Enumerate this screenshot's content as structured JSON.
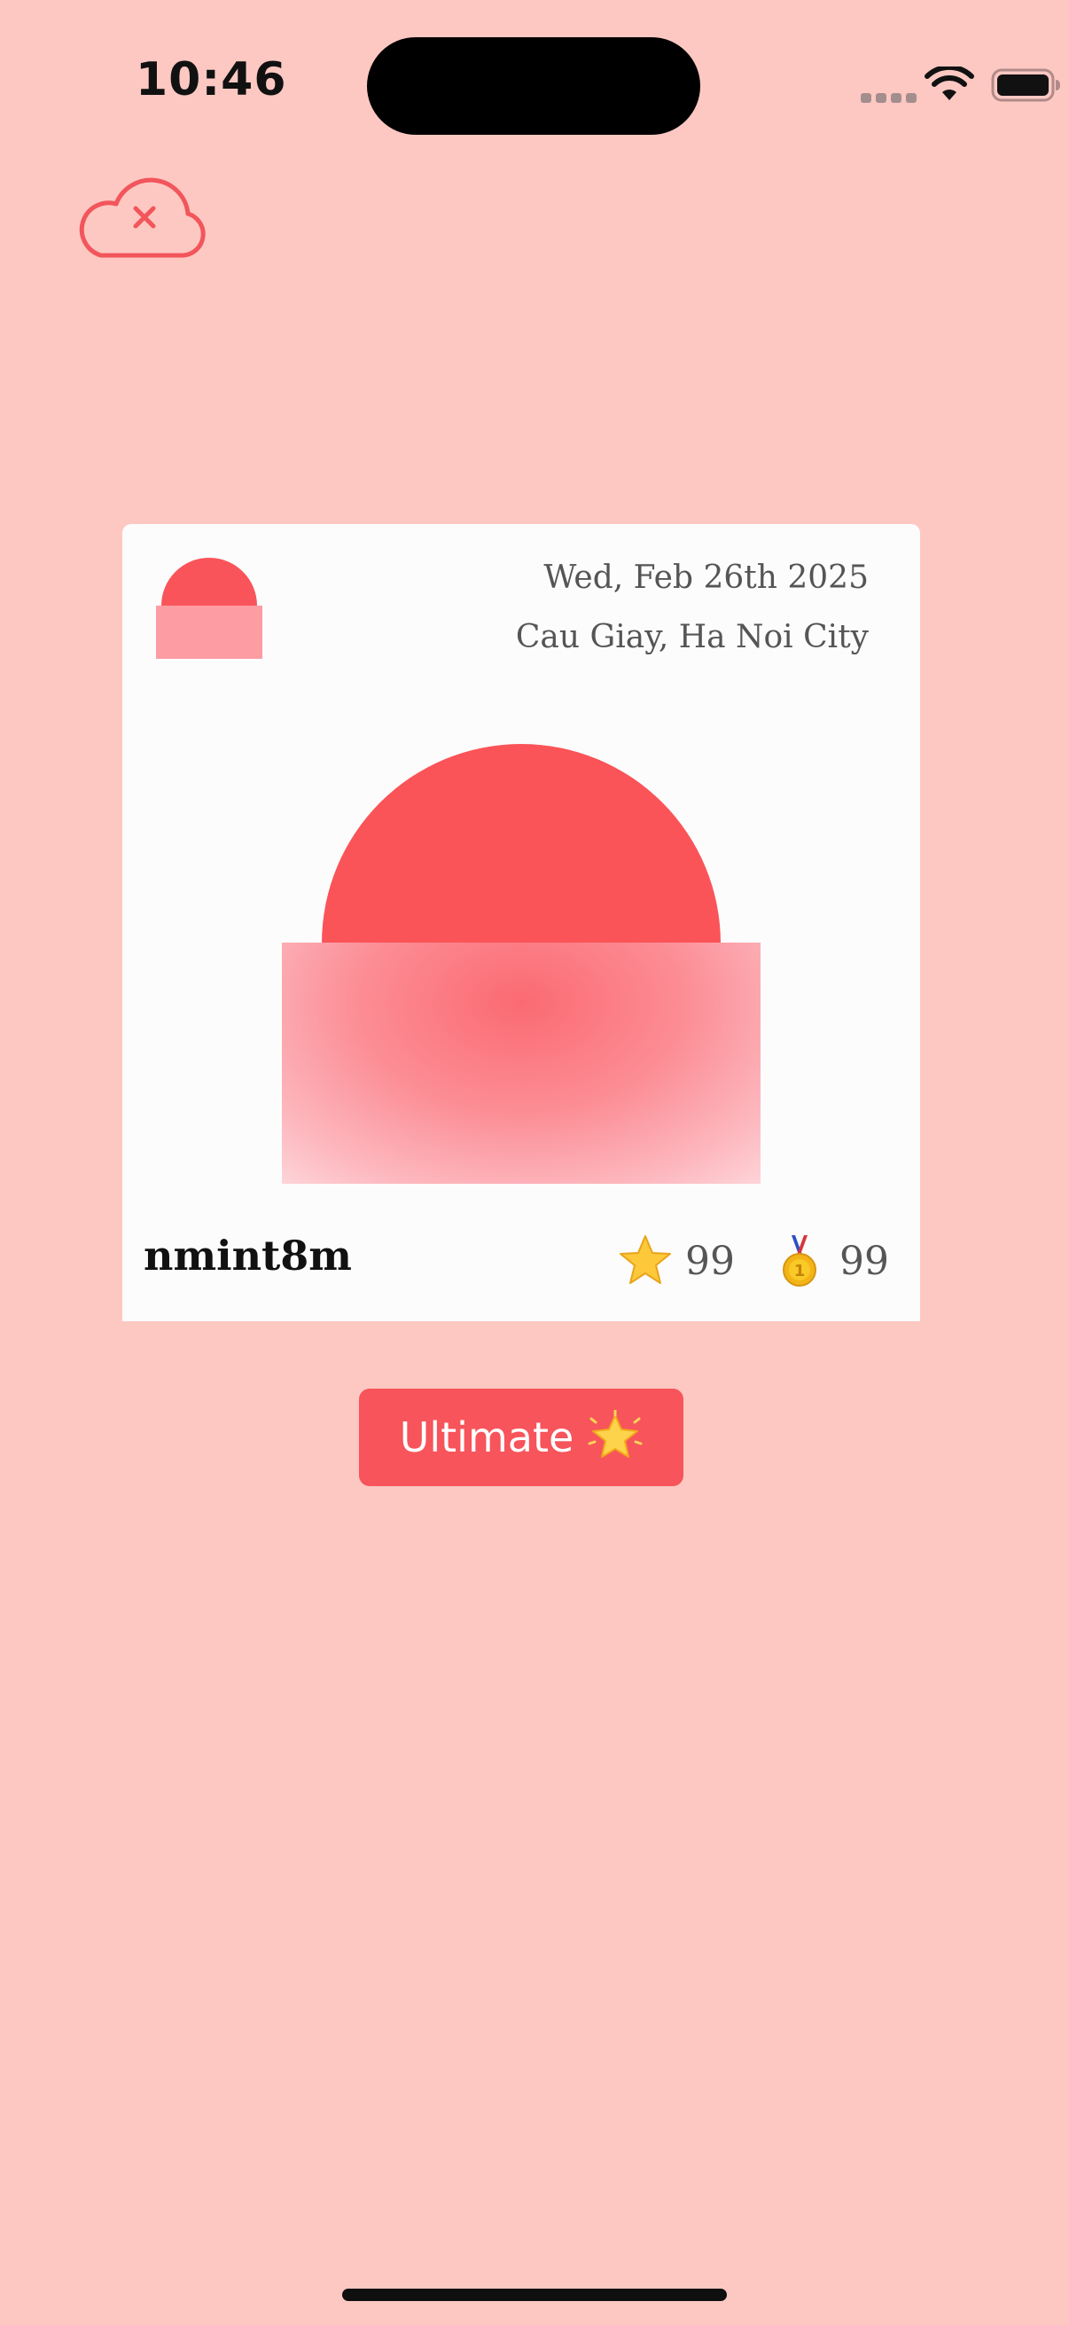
{
  "status_bar": {
    "time": "10:46",
    "icons": [
      "cellular-signal-icon",
      "wifi-icon",
      "battery-icon"
    ]
  },
  "toolbar": {
    "sync_icon": "cloud-offline-icon"
  },
  "card": {
    "date": "Wed, Feb 26th 2025",
    "location": "Cau Giay, Ha Noi City",
    "username": "nmint8m",
    "stats": [
      {
        "icon": "star-icon",
        "value": "99"
      },
      {
        "icon": "medal-icon",
        "value": "99"
      }
    ]
  },
  "actions": {
    "ultimate_label": "Ultimate",
    "ultimate_icon": "sparkle-star-icon"
  },
  "colors": {
    "background": "#fdc8c2",
    "accent": "#f7545b",
    "card": "#fcfcfc"
  }
}
